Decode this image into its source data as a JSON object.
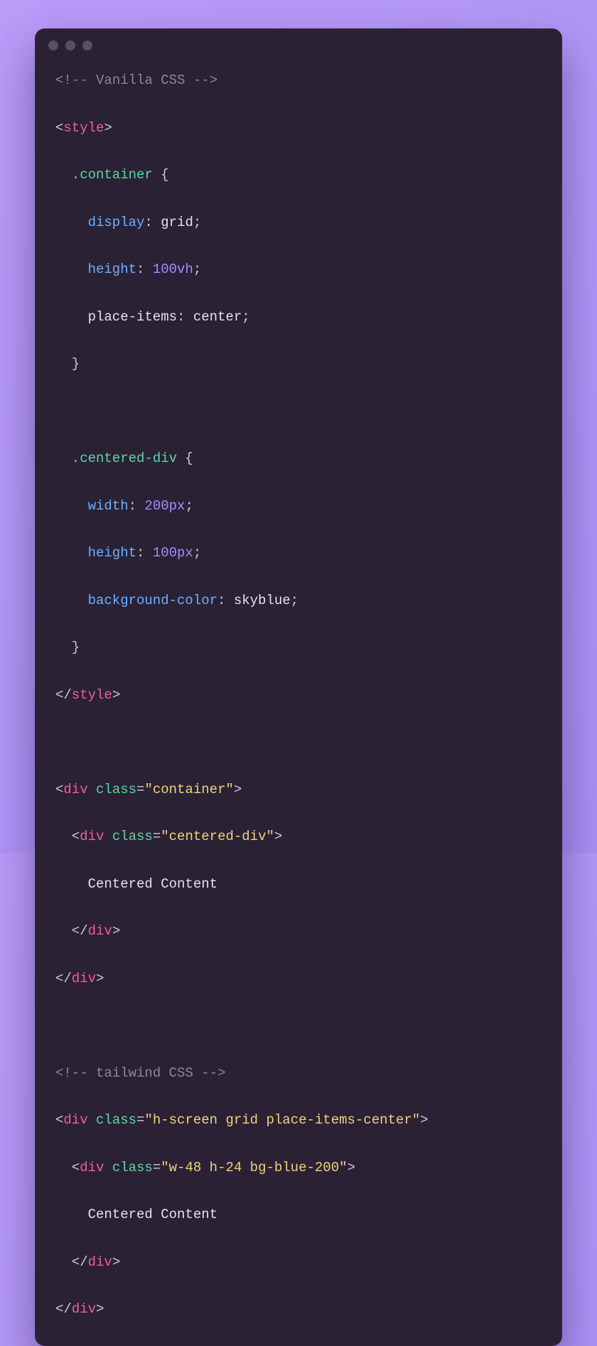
{
  "comments": {
    "vanilla": "<!-- Vanilla CSS -->",
    "tailwind": "<!-- tailwind CSS -->"
  },
  "tags": {
    "style_open_lt": "<",
    "style_open_name": "style",
    "style_open_gt": ">",
    "style_close_lt": "</",
    "style_close_name": "style",
    "style_close_gt": ">",
    "div_open_lt": "<",
    "div_name": "div",
    "div_gt": ">",
    "div_close_lt": "</",
    "div_close_gt": ">"
  },
  "attr": {
    "class_name": "class",
    "eq": "="
  },
  "html_values": {
    "container": "\"container\"",
    "centered_div": "\"centered-div\"",
    "tw_outer": "\"h-screen grid place-items-center\"",
    "tw_inner": "\"w-48 h-24 bg-blue-200\""
  },
  "text": {
    "centered_content": "Centered Content"
  },
  "css": {
    "container_sel": ".container",
    "centered_sel": ".centered-div",
    "open_brace": " {",
    "close_brace": "}",
    "colon_sp": ": ",
    "semi": ";",
    "props": {
      "display": "display",
      "height": "height",
      "place_items": "place-items",
      "width": "width",
      "bg_color": "background-color"
    },
    "vals": {
      "grid": "grid",
      "h100vh": "100vh",
      "center": "center",
      "w200px": "200px",
      "h100px": "100px",
      "skyblue": "skyblue"
    }
  }
}
